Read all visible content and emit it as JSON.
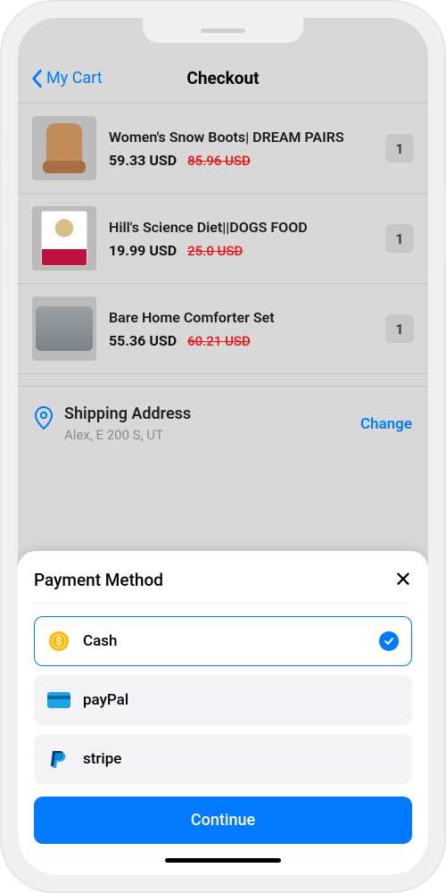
{
  "nav": {
    "back": "My Cart",
    "title": "Checkout"
  },
  "items": [
    {
      "name": "Women's Snow Boots| DREAM PAIRS",
      "price": "59.33 USD",
      "orig": "85.96 USD",
      "qty": "1"
    },
    {
      "name": "Hill's Science Diet||DOGS FOOD",
      "price": "19.99 USD",
      "orig": "25.0 USD",
      "qty": "1"
    },
    {
      "name": "Bare Home Comforter Set",
      "price": "55.36 USD",
      "orig": "60.21 USD",
      "qty": "1"
    }
  ],
  "shipping": {
    "title": "Shipping Address",
    "address": "Alex, E 200 S, UT",
    "change": "Change"
  },
  "sheet": {
    "title": "Payment Method",
    "options": [
      {
        "label": "Cash",
        "selected": true,
        "icon": "coin"
      },
      {
        "label": "payPal",
        "selected": false,
        "icon": "card"
      },
      {
        "label": "stripe",
        "selected": false,
        "icon": "pp"
      }
    ],
    "cta": "Continue"
  }
}
